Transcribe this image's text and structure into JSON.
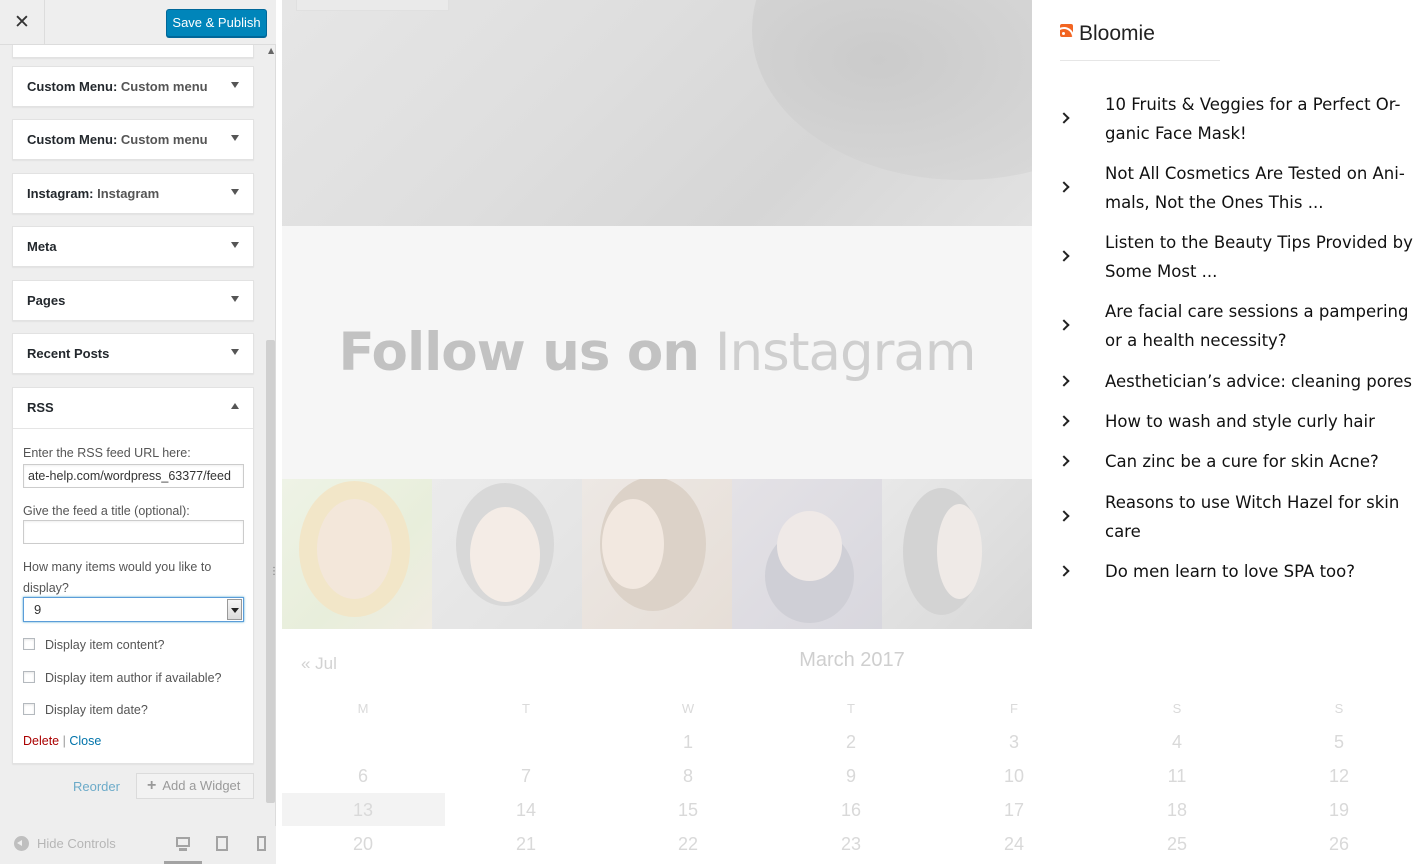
{
  "topbar": {
    "close_glyph": "✕",
    "publish_label": "Save & Publish"
  },
  "widgets": [
    {
      "title": "Custom Menu",
      "subtitle": "Custom menu"
    },
    {
      "title": "Custom Menu",
      "subtitle": "Custom menu"
    },
    {
      "title": "Instagram",
      "subtitle": "Instagram"
    },
    {
      "title": "Meta",
      "subtitle": ""
    },
    {
      "title": "Pages",
      "subtitle": ""
    },
    {
      "title": "Recent Posts",
      "subtitle": ""
    }
  ],
  "rss_widget": {
    "title": "RSS",
    "url_label": "Enter the RSS feed URL here:",
    "url_value": "ate-help.com/wordpress_63377/feed",
    "title_label": "Give the feed a title (optional):",
    "title_value": "",
    "count_label_1": "How many items would you like to",
    "count_label_2": "display?",
    "count_value": "9",
    "opt_content": "Display item content?",
    "opt_author": "Display item author if available?",
    "opt_date": "Display item date?",
    "delete_label": "Delete",
    "separator": "|",
    "close_label": "Close"
  },
  "panel_actions": {
    "reorder_label": "Reorder",
    "add_widget_label": "Add a Widget",
    "hide_controls_label": "Hide Controls"
  },
  "preview": {
    "follow_bold": "Follow us on",
    "follow_light": "Instagram",
    "calendar": {
      "prev_label": "« Jul",
      "month_title": "March 2017",
      "weekdays": [
        "M",
        "T",
        "W",
        "T",
        "F",
        "S",
        "S"
      ],
      "rows": [
        [
          "",
          "",
          "1",
          "2",
          "3",
          "4",
          "5"
        ],
        [
          "6",
          "7",
          "8",
          "9",
          "10",
          "11",
          "12"
        ],
        [
          "13",
          "14",
          "15",
          "16",
          "17",
          "18",
          "19"
        ],
        [
          "20",
          "21",
          "22",
          "23",
          "24",
          "25",
          "26"
        ]
      ]
    },
    "rss_feed": {
      "title": "Bloomie",
      "items": [
        "10 Fruits & Veggies for a Perfect Or-ganic Face Mask!",
        "Not All Cosmetics Are Tested on Ani-mals, Not the Ones This ...",
        "Listen to the Beauty Tips Provided by Some Most ...",
        "Are facial care sessions a pampering or a health necessity?",
        "Aesthetician’s advice: cleaning pores",
        "How to wash and style curly hair",
        "Can zinc be a cure for skin Acne?",
        "Reasons to use Witch Hazel for skin care",
        "Do men learn to love SPA too?"
      ]
    }
  },
  "colors": {
    "primary_button": "#0085ba",
    "link": "#0073aa",
    "delete": "#aa0000",
    "rss_orange": "#f26522"
  }
}
